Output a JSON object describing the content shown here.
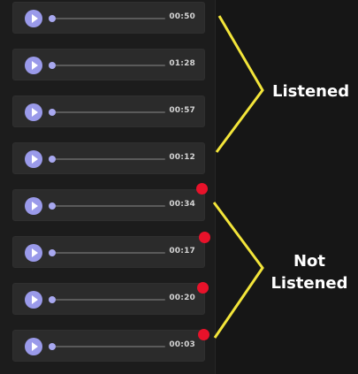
{
  "players": [
    {
      "time": "00:50",
      "status": "listened"
    },
    {
      "time": "01:28",
      "status": "listened"
    },
    {
      "time": "00:57",
      "status": "listened"
    },
    {
      "time": "00:12",
      "status": "listened"
    },
    {
      "time": "00:34",
      "status": "not_listened"
    },
    {
      "time": "00:17",
      "status": "not_listened"
    },
    {
      "time": "00:20",
      "status": "not_listened"
    },
    {
      "time": "00:03",
      "status": "not_listened"
    }
  ],
  "annotations": {
    "listened": "Listened",
    "not_listened_line1": "Not",
    "not_listened_line2": "Listened"
  },
  "colors": {
    "play_button": "#9a9aea",
    "unread_dot": "#e8122a",
    "bracket": "#f3e53a"
  }
}
